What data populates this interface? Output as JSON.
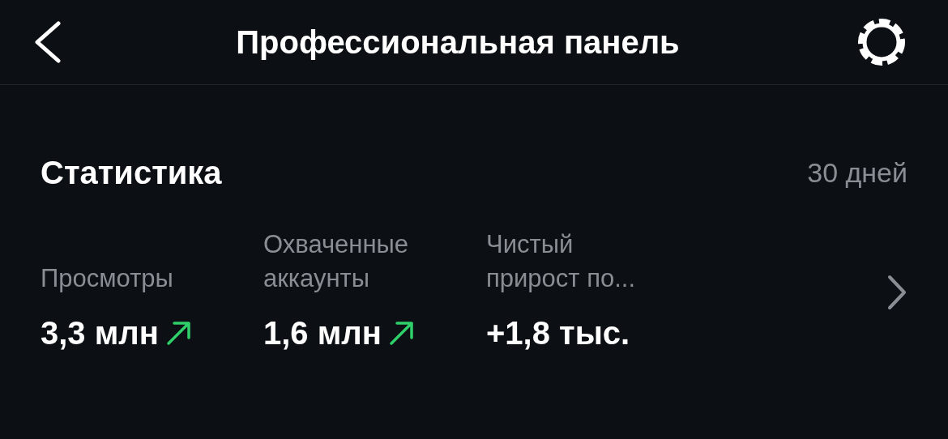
{
  "header": {
    "title": "Профессиональная панель"
  },
  "stats": {
    "title": "Статистика",
    "period": "30 дней",
    "metrics": [
      {
        "label": "Просмотры",
        "value": "3,3 млн",
        "trend_up": true
      },
      {
        "label": "Охваченные аккаунты",
        "value": "1,6 млн",
        "trend_up": true
      },
      {
        "label": "Чистый прирост по...",
        "value": "+1,8 тыс.",
        "trend_up": false
      }
    ]
  }
}
